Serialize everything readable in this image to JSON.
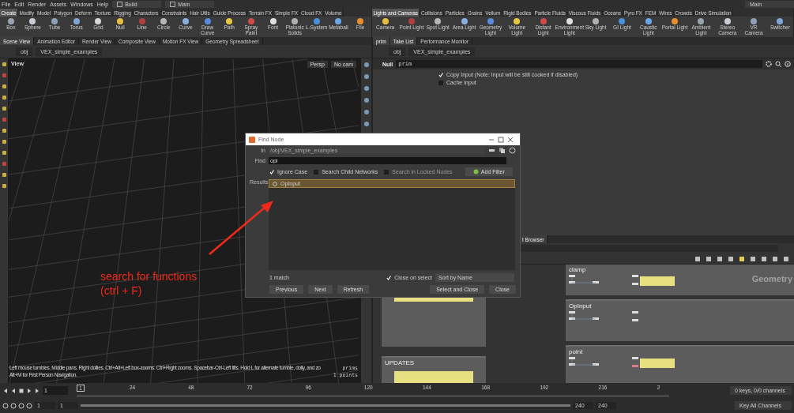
{
  "menu_bar": {
    "items": [
      "File",
      "Edit",
      "Render",
      "Assets",
      "Windows",
      "Help"
    ],
    "desktops": [
      "Build",
      "Main"
    ],
    "right_desktop": "Main"
  },
  "shelf_left": {
    "tabs": [
      {
        "label": "Create",
        "selected": true
      },
      {
        "label": "Modify",
        "selected": false
      },
      {
        "label": "Model",
        "selected": false
      },
      {
        "label": "Polygon",
        "selected": false
      },
      {
        "label": "Deform",
        "selected": false
      },
      {
        "label": "Texture",
        "selected": false
      },
      {
        "label": "Rigging",
        "selected": false
      },
      {
        "label": "Characters",
        "selected": false
      },
      {
        "label": "Constraints",
        "selected": false
      },
      {
        "label": "Hair Utils",
        "selected": false
      },
      {
        "label": "Guide Process",
        "selected": false
      },
      {
        "label": "Terrain FX",
        "selected": false
      },
      {
        "label": "Simple FX",
        "selected": false
      },
      {
        "label": "Cloud FX",
        "selected": false
      },
      {
        "label": "Volume",
        "selected": false
      }
    ],
    "tools": [
      "Box",
      "Sphere",
      "Tube",
      "Torus",
      "Grid",
      "Null",
      "Line",
      "Circle",
      "Curve",
      "Draw Curve",
      "Path",
      "Spray Paint",
      "Font",
      "Platonic Solids",
      "L-System",
      "Metaball",
      "File"
    ]
  },
  "shelf_right": {
    "tabs": [
      {
        "label": "Lights and Cameras",
        "selected": true
      },
      {
        "label": "Collisions",
        "selected": false
      },
      {
        "label": "Particles",
        "selected": false
      },
      {
        "label": "Grains",
        "selected": false
      },
      {
        "label": "Vellum",
        "selected": false
      },
      {
        "label": "Rigid Bodies",
        "selected": false
      },
      {
        "label": "Particle Fluids",
        "selected": false
      },
      {
        "label": "Viscous Fluids",
        "selected": false
      },
      {
        "label": "Oceans",
        "selected": false
      },
      {
        "label": "Pyro FX",
        "selected": false
      },
      {
        "label": "FEM",
        "selected": false
      },
      {
        "label": "Wires",
        "selected": false
      },
      {
        "label": "Crowds",
        "selected": false
      },
      {
        "label": "Drive Simulation",
        "selected": false
      }
    ],
    "tools": [
      "Camera",
      "Point Light",
      "Spot Light",
      "Area Light",
      "Geometry Light",
      "Volume Light",
      "Distant Light",
      "Environment Light",
      "Sky Light",
      "GI Light",
      "Caustic Light",
      "Portal Light",
      "Ambient Light",
      "Stereo Camera",
      "VR Camera",
      "Switcher"
    ]
  },
  "left_pane": {
    "tabs": [
      {
        "label": "Scene View",
        "selected": true
      },
      {
        "label": "Animation Editor",
        "selected": false
      },
      {
        "label": "Render View",
        "selected": false
      },
      {
        "label": "Composite View",
        "selected": false
      },
      {
        "label": "Motion FX View",
        "selected": false
      },
      {
        "label": "Geometry Spreadsheet",
        "selected": false
      }
    ],
    "path": [
      "obj",
      "VEX_simple_examples"
    ],
    "viewport": {
      "title": "View",
      "camera_buttons": [
        "Persp",
        "No cam"
      ],
      "annotation": [
        "search for functions",
        "(ctrl + F)"
      ],
      "help": [
        "Left mouse tumbles. Middle pans. Right dollies. Ctrl+Alt+Left box-zooms. Ctrl+Right zooms. Spacebar-Ctrl-Left tilts. Hold L for alternate tumble, dolly, and zo",
        "Alt+M for First Person Navigation."
      ],
      "stats": [
        "prims",
        "1 points"
      ]
    }
  },
  "right_top": {
    "tabs": [
      {
        "label": "prim",
        "selected": true
      },
      {
        "label": "Take List",
        "selected": true
      },
      {
        "label": "Performance Monitor",
        "selected": false
      }
    ],
    "path": [
      "obj",
      "VEX_simple_examples"
    ],
    "node": {
      "type": "Null",
      "name": "prim"
    },
    "params": [
      {
        "label": "Copy Input (Note: Input will be still cooked if disabled)",
        "checked": true
      },
      {
        "label": "Cache Input",
        "checked": false
      }
    ]
  },
  "network": {
    "tab": "t Browser",
    "context": "Geometry",
    "boxes": [
      {
        "kind": "sticky"
      },
      {
        "title": "UPDATES",
        "kind": "sticky"
      },
      {
        "title": "clamp",
        "kind": "nodes"
      },
      {
        "title": "OpInput",
        "kind": "nodes"
      },
      {
        "title": "point",
        "kind": "nodes"
      }
    ]
  },
  "timeline": {
    "frame": "1",
    "marker": "1",
    "ticks": [
      "24",
      "48",
      "72",
      "96",
      "120",
      "144",
      "168",
      "192",
      "216",
      "2"
    ],
    "range_start": [
      "1",
      "1"
    ],
    "range_end": [
      "240",
      "240"
    ],
    "range_slider": {
      "level": 1
    },
    "keys": "0 keys, 0/0 channels",
    "key_button": "Key All Channels"
  },
  "find_dialog": {
    "title": "Find Node",
    "in_label": "In",
    "in_path": "/obj/VEX_simple_examples",
    "find_label": "Find",
    "find_value": "opi",
    "options": [
      {
        "label": "Ignore Case",
        "checked": true,
        "disabled": false
      },
      {
        "label": "Search Child Networks",
        "checked": false,
        "disabled": false
      },
      {
        "label": "Search in Locked Nodes",
        "checked": false,
        "disabled": true
      }
    ],
    "add_filter": "Add Filter",
    "results_label": "Results",
    "results": [
      {
        "name": "OpInput",
        "selected": true
      }
    ],
    "count": "1 match",
    "close_on_select": {
      "label": "Close on select",
      "checked": true
    },
    "sort": "Sort by Name",
    "buttons_left": [
      "Previous",
      "Next",
      "Refresh"
    ],
    "buttons_right": [
      "Select and Close",
      "Close"
    ]
  }
}
